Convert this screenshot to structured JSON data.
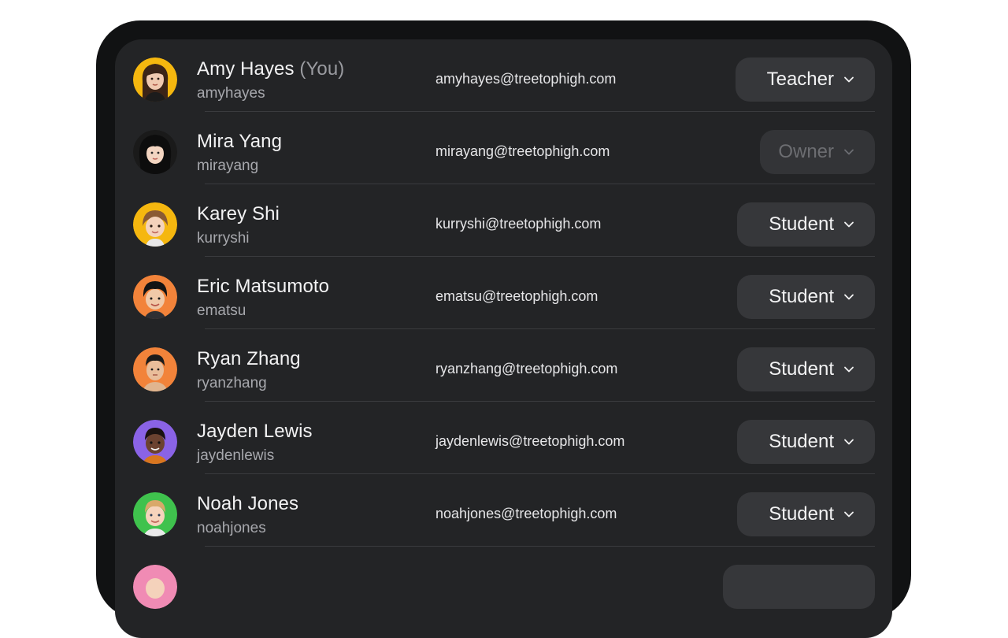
{
  "users": [
    {
      "name": "Amy Hayes",
      "you_label": "(You)",
      "username": "amyhayes",
      "email": "amyhayes@treetophigh.com",
      "role": "Teacher",
      "role_enabled": true,
      "avatar_bg": "#f5b70f"
    },
    {
      "name": "Mira Yang",
      "you_label": "",
      "username": "mirayang",
      "email": "mirayang@treetophigh.com",
      "role": "Owner",
      "role_enabled": false,
      "avatar_bg": "#1a1a1a"
    },
    {
      "name": "Karey Shi",
      "you_label": "",
      "username": "kurryshi",
      "email": "kurryshi@treetophigh.com",
      "role": "Student",
      "role_enabled": true,
      "avatar_bg": "#f5b70f"
    },
    {
      "name": "Eric Matsumoto",
      "you_label": "",
      "username": "ematsu",
      "email": "ematsu@treetophigh.com",
      "role": "Student",
      "role_enabled": true,
      "avatar_bg": "#f2833a"
    },
    {
      "name": "Ryan Zhang",
      "you_label": "",
      "username": "ryanzhang",
      "email": "ryanzhang@treetophigh.com",
      "role": "Student",
      "role_enabled": true,
      "avatar_bg": "#f2833a"
    },
    {
      "name": "Jayden Lewis",
      "you_label": "",
      "username": "jaydenlewis",
      "email": "jaydenlewis@treetophigh.com",
      "role": "Student",
      "role_enabled": true,
      "avatar_bg": "#8a63e6"
    },
    {
      "name": "Noah Jones",
      "you_label": "",
      "username": "noahjones",
      "email": "noahjones@treetophigh.com",
      "role": "Student",
      "role_enabled": true,
      "avatar_bg": "#3fc24d"
    }
  ],
  "icons": {
    "role_dropdown": "chevron-down-icon",
    "avatar": "avatar"
  }
}
